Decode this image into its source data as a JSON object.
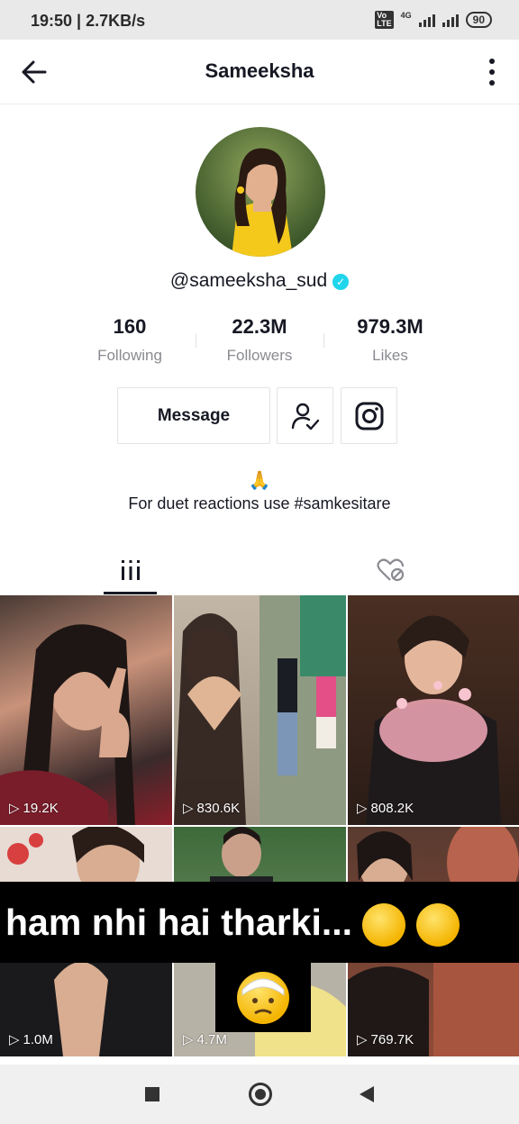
{
  "status_bar": {
    "time": "19:50 | 2.7KB/s",
    "network_badge": "VoLTE",
    "signal_4g": "4G",
    "battery": "90"
  },
  "header": {
    "title": "Sameeksha",
    "back_icon": "arrow-left-icon",
    "more_icon": "vertical-dots-icon"
  },
  "profile": {
    "username": "@sameeksha_sud",
    "verified_icon": "verified-check-icon",
    "verified_color": "#20d5ec",
    "stats": [
      {
        "value": "160",
        "label": "Following"
      },
      {
        "value": "22.3M",
        "label": "Followers"
      },
      {
        "value": "979.3M",
        "label": "Likes"
      }
    ],
    "message_button": "Message",
    "follow_icon": "person-check-icon",
    "instagram_icon": "instagram-icon",
    "bio_emoji": "🙏",
    "bio": "For duet reactions use #samkesitare"
  },
  "tabs": [
    {
      "icon": "grid-icon",
      "active": true
    },
    {
      "icon": "liked-hidden-icon",
      "active": false
    }
  ],
  "videos": [
    {
      "views": "19.2K"
    },
    {
      "views": "830.6K"
    },
    {
      "views": "808.2K"
    },
    {
      "views": "1.0M"
    },
    {
      "views": "4.7M"
    },
    {
      "views": "769.7K"
    }
  ],
  "overlay_caption": {
    "text": "ham nhi hai tharki...",
    "emoji_icon": "unamused-face-icon",
    "second_line_icon": "head-bandage-face-icon"
  },
  "system_nav": {
    "recents_icon": "square-icon",
    "home_icon": "circle-icon",
    "back_icon": "triangle-back-icon"
  }
}
